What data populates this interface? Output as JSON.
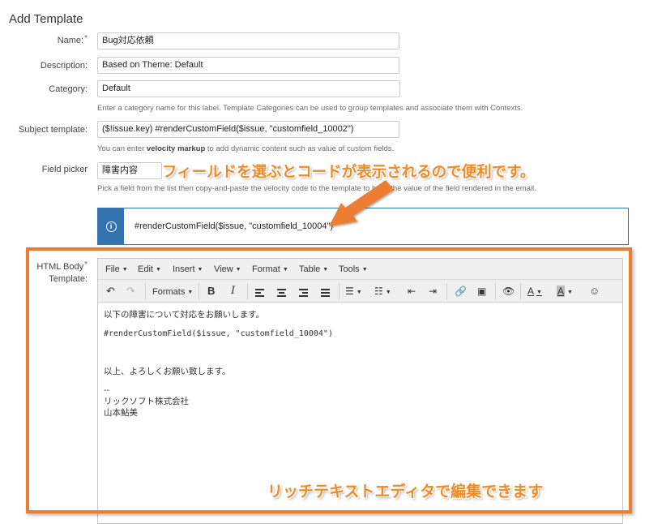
{
  "page_title": "Add Template",
  "form": {
    "name": {
      "label": "Name:",
      "required": "*",
      "value": "Bug対応依頼"
    },
    "description": {
      "label": "Description:",
      "value": "Based on Theme: Default"
    },
    "category": {
      "label": "Category:",
      "value": "Default",
      "help": "Enter a category name for this label. Template Categories can be used to group templates and associate them with Contexts."
    },
    "subject": {
      "label": "Subject template:",
      "value": "($!issue.key) #renderCustomField($issue, \"customfield_10002\")",
      "help_pre": "You can enter ",
      "help_bold": "velocity markup",
      "help_post": " to add dynamic content such as value of custom fields."
    },
    "field_picker": {
      "label": "Field picker",
      "value": "障害内容",
      "help": "Pick a field from the list then copy-and-paste the velocity code to the template to have the value of the field rendered in the email."
    },
    "info_code": "#renderCustomField($issue, \"customfield_10004\")",
    "html_body": {
      "label_line1": "HTML Body",
      "label_line2": "Template:",
      "required": "*"
    }
  },
  "editor": {
    "menus": [
      "File",
      "Edit",
      "Insert",
      "View",
      "Format",
      "Table",
      "Tools"
    ],
    "formats_label": "Formats",
    "content": {
      "line1": "以下の障害について対応をお願いします。",
      "line2": "#renderCustomField($issue, \"customfield_10004\")",
      "line3": "以上、よろしくお願い致します。",
      "line4": "--",
      "line5": "リックソフト株式会社",
      "line6": "山本鮎美"
    }
  },
  "annotations": {
    "top": "フィールドを選ぶとコードが表示されるので便利です。",
    "bottom": "リッチテキストエディタで編集できます"
  },
  "colors": {
    "accent_orange": "#ed7d31",
    "info_blue": "#3572b0",
    "required_red": "#d04437"
  }
}
